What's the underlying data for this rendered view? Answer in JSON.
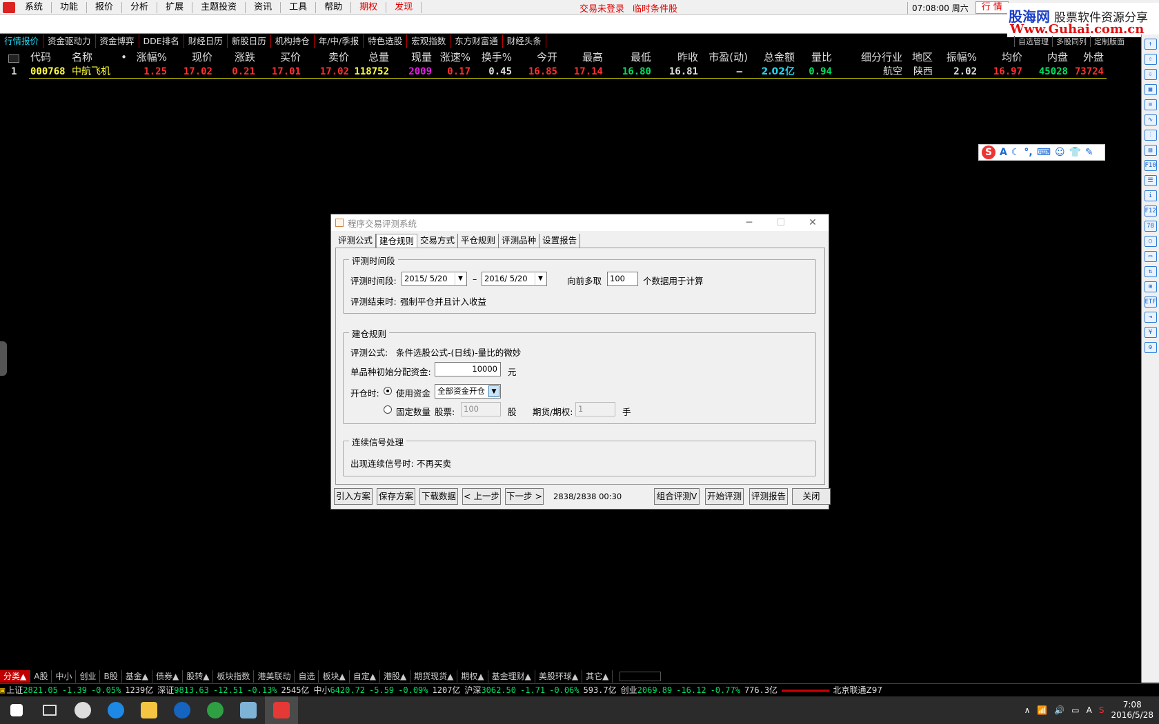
{
  "menubar": {
    "items": [
      "系统",
      "功能",
      "报价",
      "分析",
      "扩展",
      "主题投资",
      "资讯",
      "工具",
      "帮助"
    ],
    "red_items": [
      "期权",
      "发现"
    ],
    "status_left": "交易未登录",
    "status_right": "临时条件股",
    "clock": "07:08:00",
    "weekday": "周六",
    "mode_button": "行  情"
  },
  "guhai_banner": {
    "line1_name": "股海网",
    "line1_sub": "股票软件资源分享",
    "line2_url": "Www.Guhai.com.cn"
  },
  "tabs": [
    {
      "label": "行情报价",
      "active": true
    },
    {
      "label": "资金驱动力",
      "active": false
    },
    {
      "label": "资金博弈",
      "active": false
    },
    {
      "label": "DDE排名",
      "active": false
    },
    {
      "label": "财经日历",
      "active": false
    },
    {
      "label": "新股日历",
      "active": false
    },
    {
      "label": "机构持仓",
      "active": false
    },
    {
      "label": "年/中/季报",
      "active": false
    },
    {
      "label": "特色选股",
      "active": false
    },
    {
      "label": "宏观指数",
      "active": false
    },
    {
      "label": "东方财富通",
      "active": false
    },
    {
      "label": "财经头条",
      "active": false
    }
  ],
  "tabs_right": [
    "自选管理",
    "多股同列",
    "定制版面"
  ],
  "table": {
    "columns": [
      "代码",
      "名称",
      "•",
      "涨幅%",
      "现价",
      "涨跌",
      "买价",
      "卖价",
      "总量",
      "现量",
      "涨速%",
      "换手%",
      "今开",
      "最高",
      "最低",
      "昨收",
      "市盈(动)",
      "总金额",
      "量比",
      "细分行业",
      "地区",
      "振幅%",
      "均价",
      "内盘",
      "外盘"
    ],
    "row": {
      "index": "1",
      "code": "000768",
      "name": "中航飞机",
      "change_pct": "1.25",
      "price": "17.02",
      "change": "0.21",
      "bid": "17.01",
      "ask": "17.02",
      "volume": "118752",
      "cur_volume": "2009",
      "speed": "0.17",
      "turnover": "0.45",
      "open": "16.85",
      "high": "17.14",
      "low": "16.80",
      "prev_close": "16.81",
      "pe": "—",
      "amount": "2.02亿",
      "vol_ratio": "0.94",
      "industry": "航空",
      "region": "陕西",
      "amplitude": "2.02",
      "avg_price": "16.97",
      "inner": "45028",
      "outer": "73724"
    }
  },
  "dialog": {
    "title": "程序交易评测系统",
    "tabs": [
      "评测公式",
      "建仓规则",
      "交易方式",
      "平仓规则",
      "评测品种",
      "设置报告"
    ],
    "selected_tab": "建仓规则",
    "period": {
      "group_title": "评测时间段",
      "label": "评测时间段:",
      "start": "2015/ 5/20",
      "dash": "–",
      "end": "2016/ 5/20",
      "lookback_label": "向前多取",
      "lookback_value": "100",
      "lookback_suffix": "个数据用于计算",
      "end_label": "评测结束时:",
      "end_value": "强制平仓并且计入收益"
    },
    "rules": {
      "group_title": "建仓规则",
      "formula_label": "评测公式:",
      "formula_value": "条件选股公式-(日线)-量比的微妙",
      "capital_label": "单品种初始分配资金:",
      "capital_value": "10000",
      "capital_unit": "元",
      "open_label": "开仓时:",
      "use_capital_label": "使用资金",
      "use_capital_option": "全部资金开仓",
      "fixed_qty_label": "固定数量",
      "stock_label": "股票:",
      "stock_value": "100",
      "stock_unit": "股",
      "futures_label": "期货/期权:",
      "futures_value": "1",
      "futures_unit": "手"
    },
    "signal": {
      "group_title": "连续信号处理",
      "label": "出现连续信号时:",
      "value": "不再买卖"
    },
    "buttons": {
      "import": "引入方案",
      "save": "保存方案",
      "download": "下载数据",
      "prev": "< 上一步",
      "next": "下一步 >",
      "progress": "2838/2838 00:30",
      "combo": "组合评测V",
      "start": "开始评测",
      "report": "评测报告",
      "close": "关闭"
    }
  },
  "bottom_tabs": [
    "分类▲",
    "A股",
    "中小",
    "创业",
    "B股",
    "基金▲",
    "债券▲",
    "股转▲",
    "板块指数",
    "港美联动",
    "自选",
    "板块▲",
    "自定▲",
    "港股▲",
    "期货现货▲",
    "期权▲",
    "基金理财▲",
    "美股环球▲",
    "其它▲"
  ],
  "index_bar": {
    "sh_label": "上证",
    "sh_value": "2821.05",
    "sh_change": "-1.39",
    "sh_pct": "-0.05%",
    "sh_amount": "1239亿",
    "sz_label": "深证",
    "sz_value": "9813.63",
    "sz_change": "-12.51",
    "sz_pct": "-0.13%",
    "sz_amount": "2545亿",
    "zx_label": "中小",
    "zx_value": "6420.72",
    "zx_change": "-5.59",
    "zx_pct": "-0.09%",
    "zx_amount": "1207亿",
    "hs_label": "沪深",
    "hs_value": "3062.50",
    "hs_change": "-1.71",
    "hs_pct": "-0.06%",
    "hs_amount": "593.7亿",
    "cy_label": "创业",
    "cy_value": "2069.89",
    "cy_change": "-16.12",
    "cy_pct": "-0.77%",
    "cy_amount": "776.3亿",
    "server": "北京联通Z97"
  },
  "taskbar": {
    "time": "7:08",
    "date": "2016/5/28",
    "ime": "A"
  },
  "colors": {
    "up": "#ff3030",
    "down": "#00e060",
    "neutral": "#e0e0e0",
    "yellow": "#ffff40",
    "cyan": "#22d3ee",
    "magenta": "#e020e0"
  }
}
